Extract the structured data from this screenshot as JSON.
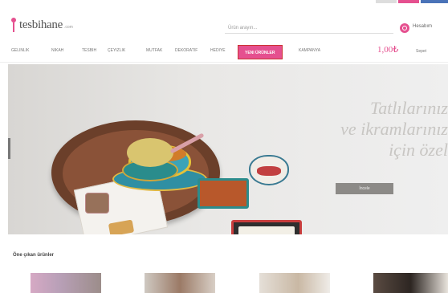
{
  "brand": {
    "name": "tesbihane",
    "sub": ".com"
  },
  "header": {
    "search_placeholder": "Ürün arayın...",
    "account_label": "Hesabım"
  },
  "nav": {
    "items": [
      "Gelinlik",
      "Nikah",
      "Tesbih",
      "Çeyizlik",
      "Mutfak",
      "Dekoratif",
      "Hediye",
      "Yeni Ürünler",
      "Kampanya"
    ],
    "active_index": 7,
    "cart_price": "1,00₺",
    "cart_label": "Sepet"
  },
  "hero": {
    "lines": [
      "Tatlılarınız",
      "ve ikramlarınız",
      "için özel"
    ],
    "button_label": "İncele"
  },
  "products": {
    "section_title": "Öne çıkan ürünler"
  },
  "colors": {
    "accent": "#e5508f",
    "nav_text": "#777777",
    "hero_bg": "#e9e8e6"
  },
  "icons": {
    "search": "search-icon",
    "logo": "tulip-logo-icon"
  }
}
